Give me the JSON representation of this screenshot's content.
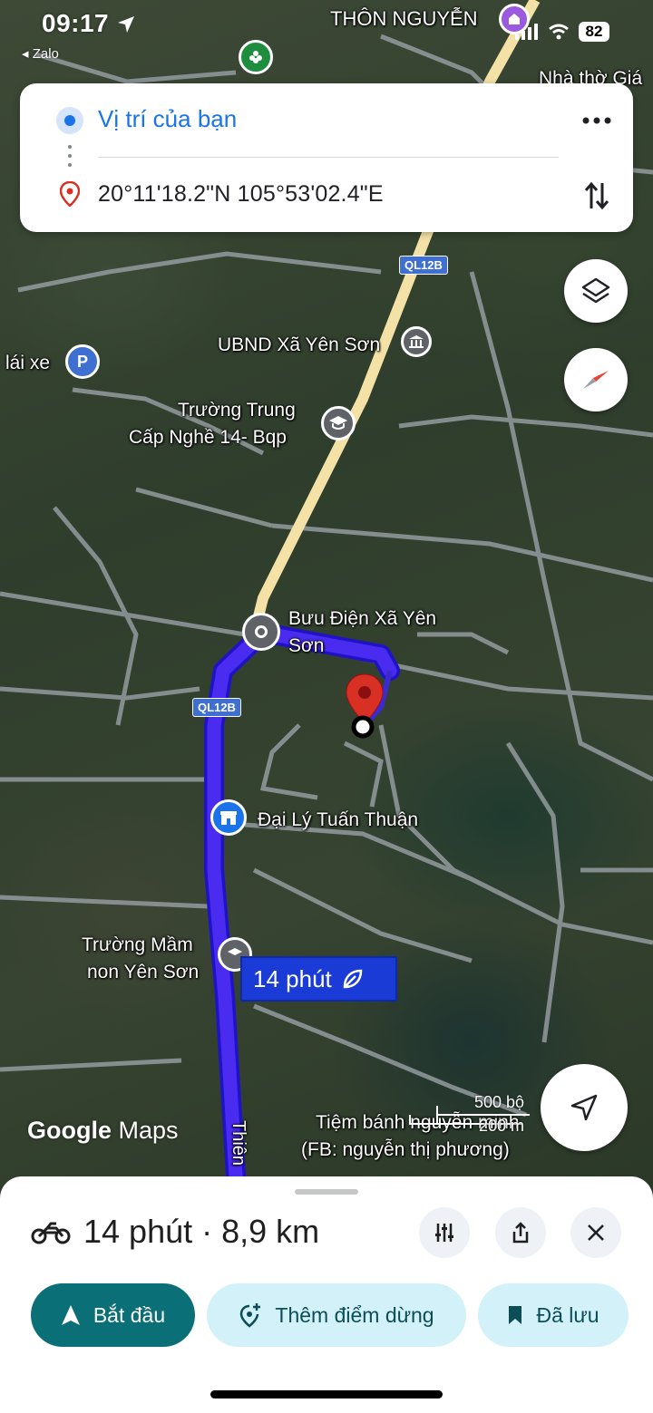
{
  "status_bar": {
    "time": "09:17",
    "back_app": "◂ Zalo",
    "battery": "82"
  },
  "directions": {
    "origin": "Vị trí của bạn",
    "destination": "20°11'18.2\"N 105°53'02.4\"E"
  },
  "map": {
    "labels": {
      "thon_nguyen": "THÔN NGUYỄN",
      "nha_tho": "Nhà thờ Giá",
      "ubnd": "UBND Xã Yên Sơn",
      "lai_xe": "lái xe",
      "truong_trung_cap_1": "Trường Trung",
      "truong_trung_cap_2": "Cấp Nghề 14- Bqp",
      "buu_dien_1": "Bưu Điện Xã Yên",
      "buu_dien_2": "Sơn",
      "dai_ly": "Đại Lý Tuấn Thuận",
      "mam_non_1": "Trường Mầm",
      "mam_non_2": "non Yên Sơn",
      "tiem_banh_1": "Tiệm bánh nguyễn minh",
      "tiem_banh_2": "(FB: nguyễn thị phương)",
      "road_name": "Thiên",
      "parking": "P"
    },
    "road_shields": [
      "QL12B",
      "QL12B"
    ],
    "route_badge": "14 phút",
    "attribution_google": "Google",
    "attribution_maps": "Maps",
    "scale_top": "500 bộ",
    "scale_bottom": "200 m"
  },
  "sheet": {
    "trip_summary": "14 phút · 8,9 km",
    "start_label": "Bắt đầu",
    "add_stop_label": "Thêm điểm dừng",
    "saved_label": "Đã lưu"
  },
  "colors": {
    "route": "#4a2cf0",
    "accent_blue": "#1a73e8",
    "start_button": "#0b6f77",
    "pin_red": "#d93025"
  },
  "icons": [
    "navigation-arrow-icon",
    "signal-icon",
    "wifi-icon",
    "more-icon",
    "swap-icon",
    "location-pin-icon",
    "layers-icon",
    "compass-icon",
    "my-location-icon",
    "motorcycle-icon",
    "route-options-icon",
    "share-icon",
    "close-icon",
    "start-arrow-icon",
    "add-stop-icon",
    "bookmark-icon"
  ]
}
